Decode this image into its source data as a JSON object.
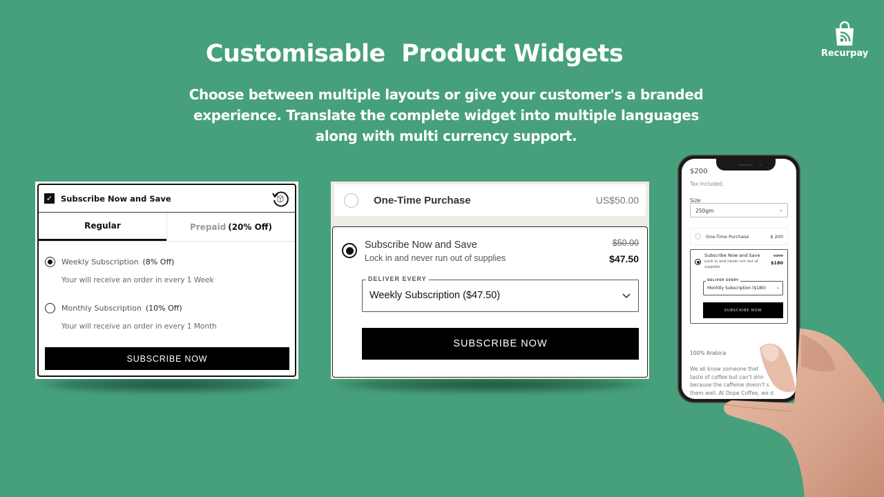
{
  "header": {
    "title": "Customisable  Product Widgets",
    "subtitle": "Choose between multiple layouts or give your customer's a branded experience. Translate the complete widget into multiple languages along with multi currency support."
  },
  "brand": {
    "name": "Recurpay",
    "icon": "shopping-bag-feed-icon"
  },
  "colors": {
    "background": "#46a07c",
    "button": "#000000",
    "text_on_bg": "#ffffff",
    "widget2_bg": "#efece4"
  },
  "widget_tabs": {
    "header_label": "Subscribe Now and Save",
    "checkbox_checked": true,
    "header_icon": "subscription-refresh-box-icon",
    "tabs": [
      {
        "label": "Regular",
        "active": true
      },
      {
        "label_muted": "Prepaid",
        "label_bold": "(20% Off)",
        "active": false
      }
    ],
    "options": [
      {
        "name": "Weekly Subscription",
        "discount": "(8% Off)",
        "description": "Your will receive an order in every 1 Week",
        "selected": true
      },
      {
        "name": "Monthly Subscription",
        "discount": "(10% Off)",
        "description": "Your will receive an order in every 1 Month",
        "selected": false
      }
    ],
    "button_label": "SUBSCRIBE NOW"
  },
  "widget_cards": {
    "one_time": {
      "label": "One-Time Purchase",
      "price": "US$50.00",
      "selected": false
    },
    "subscribe": {
      "title": "Subscribe Now and Save",
      "description": "Lock in and never run out of supplies",
      "old_price": "$50.00",
      "new_price": "$47.50",
      "selected": true
    },
    "deliver_label": "DELIVER EVERY",
    "deliver_value": "Weekly Subscription ($47.50)",
    "button_label": "SUBSCRIBE NOW"
  },
  "phone": {
    "price": "$200",
    "tax_note": "Tax included.",
    "size_label": "Size",
    "size_value": "250gm",
    "one_time": {
      "label": "One-Time Purchase",
      "price": "$ 200"
    },
    "subscribe": {
      "title": "Subscribe Now and Save",
      "description": "Lock in and never run out of supplies",
      "old_price": "$200",
      "new_price": "$180"
    },
    "deliver_label": "DELIVER EVERY",
    "deliver_value": "Monhtly Subscription ($180)",
    "button_label": "SUBSCRIBE NOW",
    "section_title": "100% Arabica",
    "body_lines": [
      "We all know someone that",
      "taste of coffee but can't drin",
      "because the caffeine doesn't s",
      "them well. At Dope Coffee, we d"
    ]
  }
}
